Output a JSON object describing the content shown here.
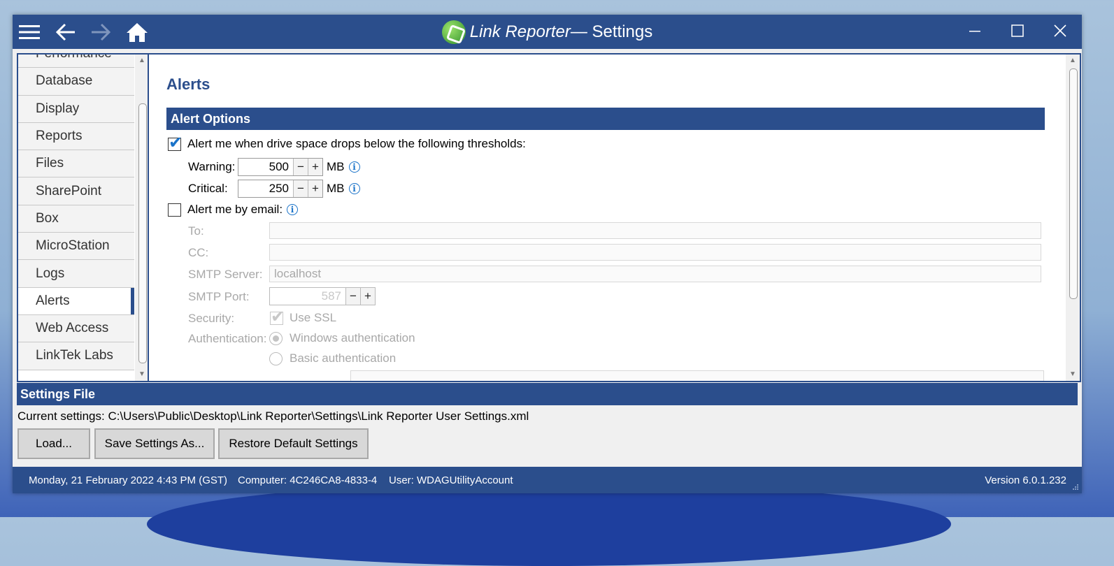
{
  "window": {
    "app_name": "Link Reporter",
    "title_suffix": " — Settings"
  },
  "sidebar": {
    "items": [
      {
        "label": "Performance"
      },
      {
        "label": "Database"
      },
      {
        "label": "Display"
      },
      {
        "label": "Reports"
      },
      {
        "label": "Files"
      },
      {
        "label": "SharePoint"
      },
      {
        "label": "Box"
      },
      {
        "label": "MicroStation"
      },
      {
        "label": "Logs"
      },
      {
        "label": "Alerts"
      },
      {
        "label": "Web Access"
      },
      {
        "label": "LinkTek Labs"
      }
    ],
    "selected": "Alerts"
  },
  "alerts": {
    "page_title": "Alerts",
    "section_title": "Alert Options",
    "drive_space_label": "Alert me when drive space drops below the following thresholds:",
    "drive_space_checked": true,
    "warning_label": "Warning:",
    "warning_value": "500",
    "critical_label": "Critical:",
    "critical_value": "250",
    "unit": "MB",
    "email_label": "Alert me by email:",
    "email_checked": false,
    "to_label": "To:",
    "to_value": "",
    "cc_label": "CC:",
    "cc_value": "",
    "smtp_server_label": "SMTP Server:",
    "smtp_server_value": "localhost",
    "smtp_port_label": "SMTP Port:",
    "smtp_port_value": "587",
    "security_label": "Security:",
    "use_ssl_label": "Use SSL",
    "authentication_label": "Authentication:",
    "windows_auth_label": "Windows authentication",
    "basic_auth_label": "Basic authentication"
  },
  "settings_file": {
    "section_title": "Settings File",
    "current_settings": "Current settings: C:\\Users\\Public\\Desktop\\Link Reporter\\Settings\\Link Reporter User Settings.xml",
    "load_label": "Load...",
    "save_as_label": "Save Settings As...",
    "restore_label": "Restore Default Settings"
  },
  "status": {
    "datetime": "Monday, 21 February 2022 4:43 PM (GST)",
    "computer": "Computer: 4C246CA8-4833-4",
    "user": "User: WDAGUtilityAccount",
    "version": "Version 6.0.1.232"
  },
  "colors": {
    "accent": "#2b4e8c",
    "info": "#1a73c9"
  }
}
